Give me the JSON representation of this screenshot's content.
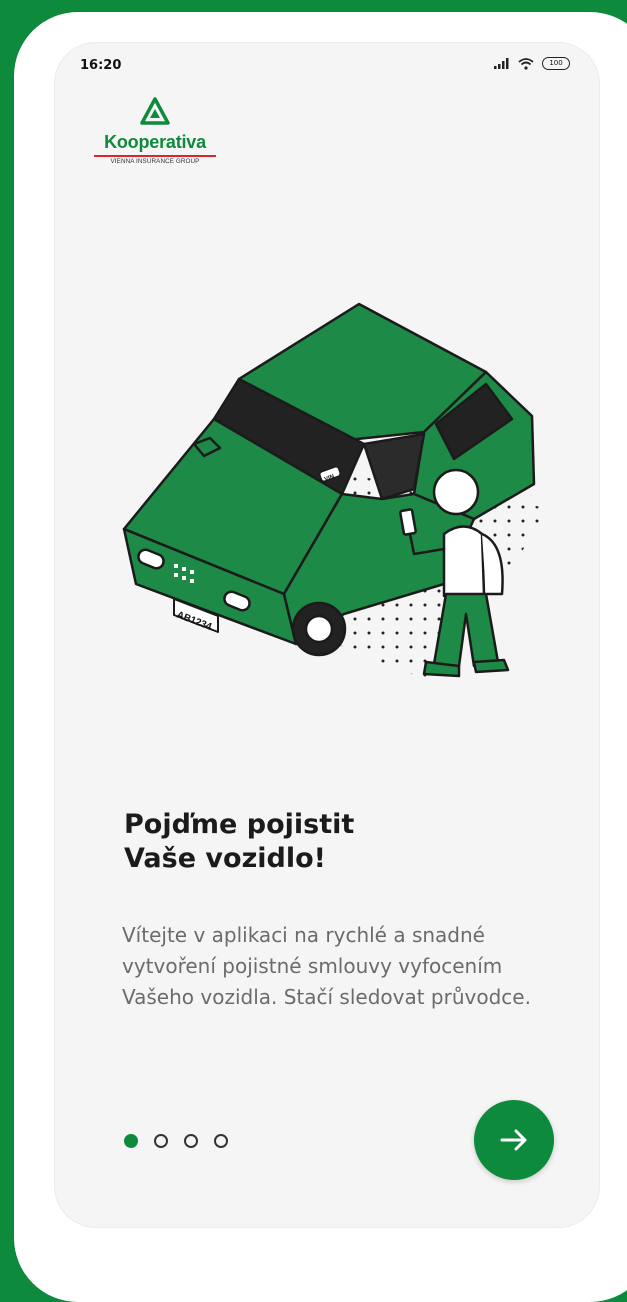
{
  "status_bar": {
    "time": "16:20",
    "battery": "100"
  },
  "logo": {
    "name": "Kooperativa",
    "subtitle": "VIENNA INSURANCE GROUP"
  },
  "illustration": {
    "plate_text": "AB1234",
    "sticker_text": "VIN"
  },
  "onboarding": {
    "title_line1": "Pojďme pojistit",
    "title_line2": "Vaše vozidlo!",
    "description": "Vítejte v aplikaci na rychlé a snadné vytvoření pojistné smlouvy vyfocením Vašeho vozidla. Stačí sledovat průvodce.",
    "page_count": 4,
    "current_page": 1
  },
  "next_button": {
    "icon": "arrow-right-icon"
  },
  "colors": {
    "brand_green": "#0e8a3c",
    "brand_red": "#d8262c",
    "text_dark": "#1b1b1b",
    "text_muted": "#6b6b6b"
  }
}
